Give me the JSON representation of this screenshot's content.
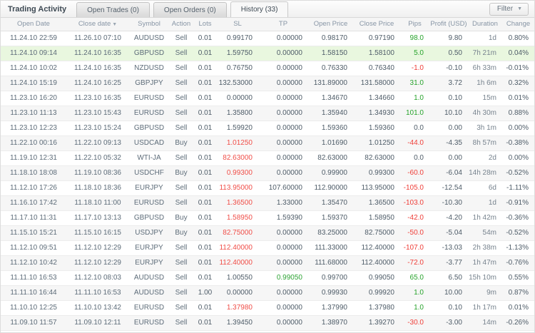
{
  "header": {
    "title": "Trading Activity",
    "tabs": [
      {
        "id": "open-trades",
        "label": "Open Trades (0)",
        "active": false
      },
      {
        "id": "open-orders",
        "label": "Open Orders (0)",
        "active": false
      },
      {
        "id": "history",
        "label": "History (33)",
        "active": true
      }
    ],
    "filter_label": "Filter",
    "filter_caret_icon": "▼"
  },
  "table": {
    "columns": [
      {
        "key": "open_date",
        "label": "Open Date",
        "align": "c"
      },
      {
        "key": "close_date",
        "label": "Close date",
        "align": "c",
        "sorted": "desc"
      },
      {
        "key": "symbol",
        "label": "Symbol",
        "align": "c"
      },
      {
        "key": "action",
        "label": "Action",
        "align": "c"
      },
      {
        "key": "lots",
        "label": "Lots",
        "align": "c"
      },
      {
        "key": "sl",
        "label": "SL",
        "align": "r"
      },
      {
        "key": "tp",
        "label": "TP",
        "align": "r"
      },
      {
        "key": "open_price",
        "label": "Open Price",
        "align": "r"
      },
      {
        "key": "close_price",
        "label": "Close Price",
        "align": "r"
      },
      {
        "key": "pips",
        "label": "Pips",
        "align": "r"
      },
      {
        "key": "profit",
        "label": "Profit (USD)",
        "align": "r"
      },
      {
        "key": "duration",
        "label": "Duration",
        "align": "r"
      },
      {
        "key": "change",
        "label": "Change",
        "align": "r"
      }
    ],
    "sort_desc_icon": "▼",
    "rows": [
      {
        "open_date": "11.24.10 22:59",
        "close_date": "11.26.10 07:10",
        "symbol": "AUDUSD",
        "action": "Sell",
        "lots": "0.01",
        "sl": "0.99170",
        "sl_hit": false,
        "tp": "0.00000",
        "tp_hit": false,
        "open_price": "0.98170",
        "close_price": "0.97190",
        "pips": "98.0",
        "profit": "9.80",
        "duration": "1d",
        "change": "0.80%",
        "highlight": false
      },
      {
        "open_date": "11.24.10 09:14",
        "close_date": "11.24.10 16:35",
        "symbol": "GBPUSD",
        "action": "Sell",
        "lots": "0.01",
        "sl": "1.59750",
        "sl_hit": false,
        "tp": "0.00000",
        "tp_hit": false,
        "open_price": "1.58150",
        "close_price": "1.58100",
        "pips": "5.0",
        "profit": "0.50",
        "duration": "7h 21m",
        "change": "0.04%",
        "highlight": true
      },
      {
        "open_date": "11.24.10 10:02",
        "close_date": "11.24.10 16:35",
        "symbol": "NZDUSD",
        "action": "Sell",
        "lots": "0.01",
        "sl": "0.76750",
        "sl_hit": false,
        "tp": "0.00000",
        "tp_hit": false,
        "open_price": "0.76330",
        "close_price": "0.76340",
        "pips": "-1.0",
        "profit": "-0.10",
        "duration": "6h 33m",
        "change": "-0.01%",
        "highlight": false
      },
      {
        "open_date": "11.24.10 15:19",
        "close_date": "11.24.10 16:25",
        "symbol": "GBPJPY",
        "action": "Sell",
        "lots": "0.01",
        "sl": "132.53000",
        "sl_hit": false,
        "tp": "0.00000",
        "tp_hit": false,
        "open_price": "131.89000",
        "close_price": "131.58000",
        "pips": "31.0",
        "profit": "3.72",
        "duration": "1h 6m",
        "change": "0.32%",
        "highlight": false
      },
      {
        "open_date": "11.23.10 16:20",
        "close_date": "11.23.10 16:35",
        "symbol": "EURUSD",
        "action": "Sell",
        "lots": "0.01",
        "sl": "0.00000",
        "sl_hit": false,
        "tp": "0.00000",
        "tp_hit": false,
        "open_price": "1.34670",
        "close_price": "1.34660",
        "pips": "1.0",
        "profit": "0.10",
        "duration": "15m",
        "change": "0.01%",
        "highlight": false
      },
      {
        "open_date": "11.23.10 11:13",
        "close_date": "11.23.10 15:43",
        "symbol": "EURUSD",
        "action": "Sell",
        "lots": "0.01",
        "sl": "1.35800",
        "sl_hit": false,
        "tp": "0.00000",
        "tp_hit": false,
        "open_price": "1.35940",
        "close_price": "1.34930",
        "pips": "101.0",
        "profit": "10.10",
        "duration": "4h 30m",
        "change": "0.88%",
        "highlight": false
      },
      {
        "open_date": "11.23.10 12:23",
        "close_date": "11.23.10 15:24",
        "symbol": "GBPUSD",
        "action": "Sell",
        "lots": "0.01",
        "sl": "1.59920",
        "sl_hit": false,
        "tp": "0.00000",
        "tp_hit": false,
        "open_price": "1.59360",
        "close_price": "1.59360",
        "pips": "0.0",
        "profit": "0.00",
        "duration": "3h 1m",
        "change": "0.00%",
        "highlight": false
      },
      {
        "open_date": "11.22.10 00:16",
        "close_date": "11.22.10 09:13",
        "symbol": "USDCAD",
        "action": "Buy",
        "lots": "0.01",
        "sl": "1.01250",
        "sl_hit": true,
        "tp": "0.00000",
        "tp_hit": false,
        "open_price": "1.01690",
        "close_price": "1.01250",
        "pips": "-44.0",
        "profit": "-4.35",
        "duration": "8h 57m",
        "change": "-0.38%",
        "highlight": false
      },
      {
        "open_date": "11.19.10 12:31",
        "close_date": "11.22.10 05:32",
        "symbol": "WTI-JA",
        "action": "Sell",
        "lots": "0.01",
        "sl": "82.63000",
        "sl_hit": true,
        "tp": "0.00000",
        "tp_hit": false,
        "open_price": "82.63000",
        "close_price": "82.63000",
        "pips": "0.0",
        "profit": "0.00",
        "duration": "2d",
        "change": "0.00%",
        "highlight": false
      },
      {
        "open_date": "11.18.10 18:08",
        "close_date": "11.19.10 08:36",
        "symbol": "USDCHF",
        "action": "Buy",
        "lots": "0.01",
        "sl": "0.99300",
        "sl_hit": true,
        "tp": "0.00000",
        "tp_hit": false,
        "open_price": "0.99900",
        "close_price": "0.99300",
        "pips": "-60.0",
        "profit": "-6.04",
        "duration": "14h 28m",
        "change": "-0.52%",
        "highlight": false
      },
      {
        "open_date": "11.12.10 17:26",
        "close_date": "11.18.10 18:36",
        "symbol": "EURJPY",
        "action": "Sell",
        "lots": "0.01",
        "sl": "113.95000",
        "sl_hit": true,
        "tp": "107.60000",
        "tp_hit": false,
        "open_price": "112.90000",
        "close_price": "113.95000",
        "pips": "-105.0",
        "profit": "-12.54",
        "duration": "6d",
        "change": "-1.11%",
        "highlight": false
      },
      {
        "open_date": "11.16.10 17:42",
        "close_date": "11.18.10 11:00",
        "symbol": "EURUSD",
        "action": "Sell",
        "lots": "0.01",
        "sl": "1.36500",
        "sl_hit": true,
        "tp": "1.33000",
        "tp_hit": false,
        "open_price": "1.35470",
        "close_price": "1.36500",
        "pips": "-103.0",
        "profit": "-10.30",
        "duration": "1d",
        "change": "-0.91%",
        "highlight": false
      },
      {
        "open_date": "11.17.10 11:31",
        "close_date": "11.17.10 13:13",
        "symbol": "GBPUSD",
        "action": "Buy",
        "lots": "0.01",
        "sl": "1.58950",
        "sl_hit": true,
        "tp": "1.59390",
        "tp_hit": false,
        "open_price": "1.59370",
        "close_price": "1.58950",
        "pips": "-42.0",
        "profit": "-4.20",
        "duration": "1h 42m",
        "change": "-0.36%",
        "highlight": false
      },
      {
        "open_date": "11.15.10 15:21",
        "close_date": "11.15.10 16:15",
        "symbol": "USDJPY",
        "action": "Buy",
        "lots": "0.01",
        "sl": "82.75000",
        "sl_hit": true,
        "tp": "0.00000",
        "tp_hit": false,
        "open_price": "83.25000",
        "close_price": "82.75000",
        "pips": "-50.0",
        "profit": "-5.04",
        "duration": "54m",
        "change": "-0.52%",
        "highlight": false
      },
      {
        "open_date": "11.12.10 09:51",
        "close_date": "11.12.10 12:29",
        "symbol": "EURJPY",
        "action": "Sell",
        "lots": "0.01",
        "sl": "112.40000",
        "sl_hit": true,
        "tp": "0.00000",
        "tp_hit": false,
        "open_price": "111.33000",
        "close_price": "112.40000",
        "pips": "-107.0",
        "profit": "-13.03",
        "duration": "2h 38m",
        "change": "-1.13%",
        "highlight": false
      },
      {
        "open_date": "11.12.10 10:42",
        "close_date": "11.12.10 12:29",
        "symbol": "EURJPY",
        "action": "Sell",
        "lots": "0.01",
        "sl": "112.40000",
        "sl_hit": true,
        "tp": "0.00000",
        "tp_hit": false,
        "open_price": "111.68000",
        "close_price": "112.40000",
        "pips": "-72.0",
        "profit": "-3.77",
        "duration": "1h 47m",
        "change": "-0.76%",
        "highlight": false
      },
      {
        "open_date": "11.11.10 16:53",
        "close_date": "11.12.10 08:03",
        "symbol": "AUDUSD",
        "action": "Sell",
        "lots": "0.01",
        "sl": "1.00550",
        "sl_hit": false,
        "tp": "0.99050",
        "tp_hit": true,
        "open_price": "0.99700",
        "close_price": "0.99050",
        "pips": "65.0",
        "profit": "6.50",
        "duration": "15h 10m",
        "change": "0.55%",
        "highlight": false
      },
      {
        "open_date": "11.11.10 16:44",
        "close_date": "11.11.10 16:53",
        "symbol": "AUDUSD",
        "action": "Sell",
        "lots": "1.00",
        "sl": "0.00000",
        "sl_hit": false,
        "tp": "0.00000",
        "tp_hit": false,
        "open_price": "0.99930",
        "close_price": "0.99920",
        "pips": "1.0",
        "profit": "10.00",
        "duration": "9m",
        "change": "0.87%",
        "highlight": false
      },
      {
        "open_date": "11.10.10 12:25",
        "close_date": "11.10.10 13:42",
        "symbol": "EURUSD",
        "action": "Sell",
        "lots": "0.01",
        "sl": "1.37980",
        "sl_hit": true,
        "tp": "0.00000",
        "tp_hit": false,
        "open_price": "1.37990",
        "close_price": "1.37980",
        "pips": "1.0",
        "profit": "0.10",
        "duration": "1h 17m",
        "change": "0.01%",
        "highlight": false
      },
      {
        "open_date": "11.09.10 11:57",
        "close_date": "11.09.10 12:11",
        "symbol": "EURUSD",
        "action": "Sell",
        "lots": "0.01",
        "sl": "1.39450",
        "sl_hit": false,
        "tp": "0.00000",
        "tp_hit": false,
        "open_price": "1.38970",
        "close_price": "1.39270",
        "pips": "-30.0",
        "profit": "-3.00",
        "duration": "14m",
        "change": "-0.26%",
        "highlight": false
      }
    ]
  },
  "colors": {
    "positive": "#27a32b",
    "negative": "#ef3d37",
    "sl_hit": "#f04e48",
    "tp_hit": "#2fa436",
    "highlight_row": "#e9f7df"
  }
}
